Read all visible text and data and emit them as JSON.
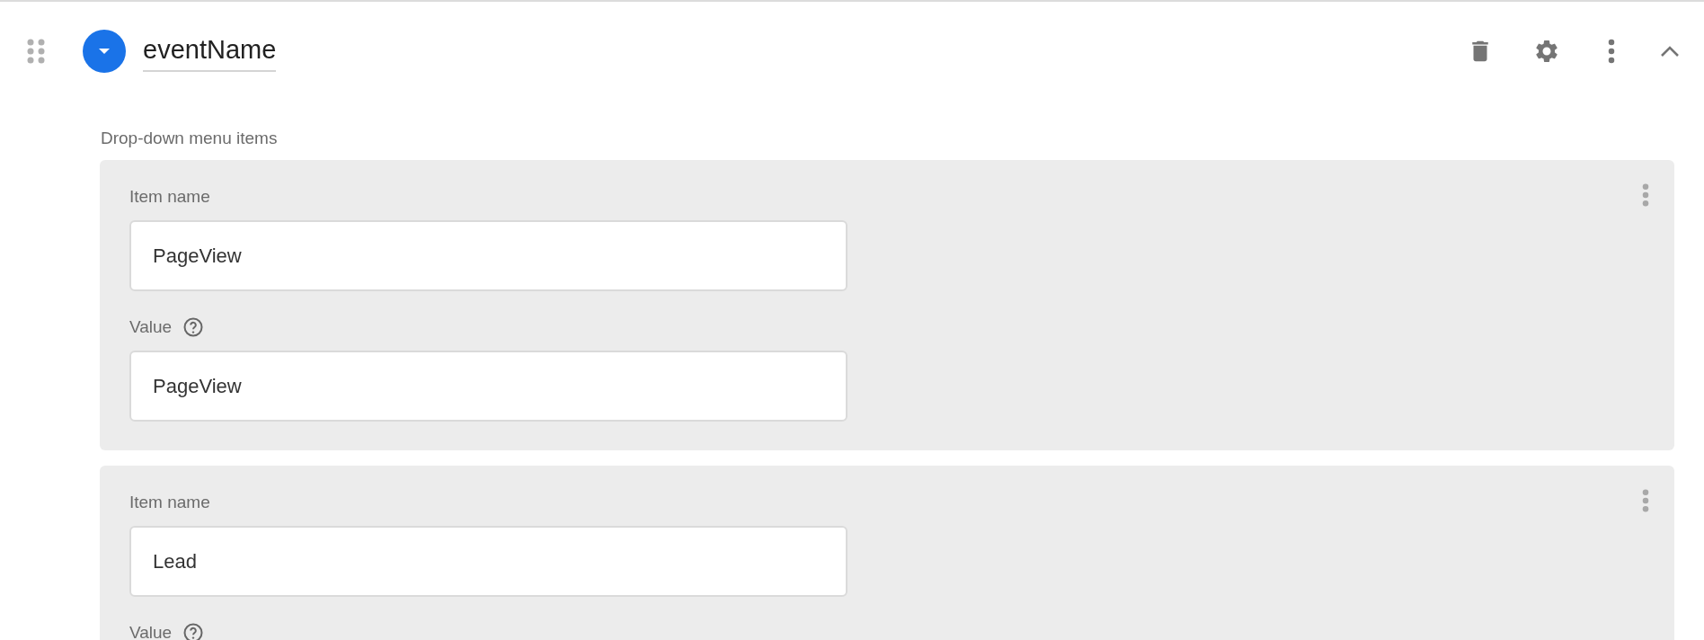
{
  "field": {
    "name": "eventName"
  },
  "section_label": "Drop-down menu items",
  "items": [
    {
      "item_name_label": "Item name",
      "item_name": "PageView",
      "value_label": "Value",
      "value": "PageView"
    },
    {
      "item_name_label": "Item name",
      "item_name": "Lead",
      "value_label": "Value"
    }
  ]
}
